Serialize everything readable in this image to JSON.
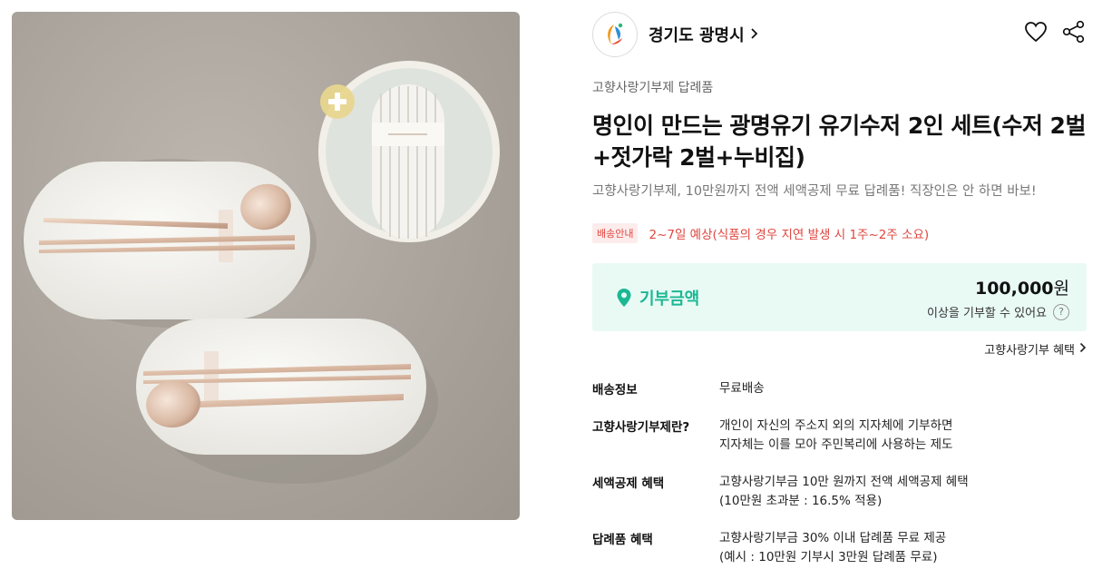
{
  "seller": {
    "name": "경기도 광명시",
    "chevron": "›"
  },
  "icons": {
    "seller_logo": "gwangmyeong-city-logo",
    "wishlist": "heart-outline-icon",
    "share": "share-icon",
    "location": "location-pin-icon",
    "help": "question-circle-icon",
    "chevron": "chevron-right-icon",
    "zoom": "plus-circle-icon"
  },
  "product": {
    "category": "고향사랑기부제 답례품",
    "title": "명인이 만드는 광명유기 유기수저 2인 세트(수저 2벌+젓가락 2벌+누비집)",
    "subtitle": "고향사랑기부제, 10만원까지 전액 세액공제 무료 답례품! 직장인은 안 하면 바보!"
  },
  "delivery": {
    "badge": "배송안내",
    "text": "2~7일 예상(식품의 경우 지연 발생 시 1주~2주 소요)"
  },
  "donation": {
    "label": "기부금액",
    "amount": "100,000",
    "currency": "원",
    "note": "이상을 기부할 수 있어요",
    "help": "?"
  },
  "benefit_link": "고향사랑기부 혜택",
  "info_rows": [
    {
      "label": "배송정보",
      "lines": [
        "무료배송"
      ]
    },
    {
      "label": "고향사랑기부제란?",
      "lines": [
        "개인이 자신의 주소지 외의 지자체에 기부하면",
        "지자체는 이를 모아 주민복리에 사용하는 제도"
      ]
    },
    {
      "label": "세액공제 혜택",
      "lines": [
        "고향사랑기부금 10만 원까지 전액 세액공제 혜택",
        "(10만원 초과분 : 16.5% 적용)"
      ]
    },
    {
      "label": "답례품 혜택",
      "lines": [
        "고향사랑기부금 30% 이내 답례품 무료 제공",
        "(예시 : 10만원 기부시 3만원 답례품 무료)"
      ]
    }
  ],
  "colors": {
    "accent_green": "#1bb893",
    "donation_bg": "#e9faf5",
    "delivery_red": "#e0463f",
    "delivery_badge_bg": "#fdecec"
  }
}
